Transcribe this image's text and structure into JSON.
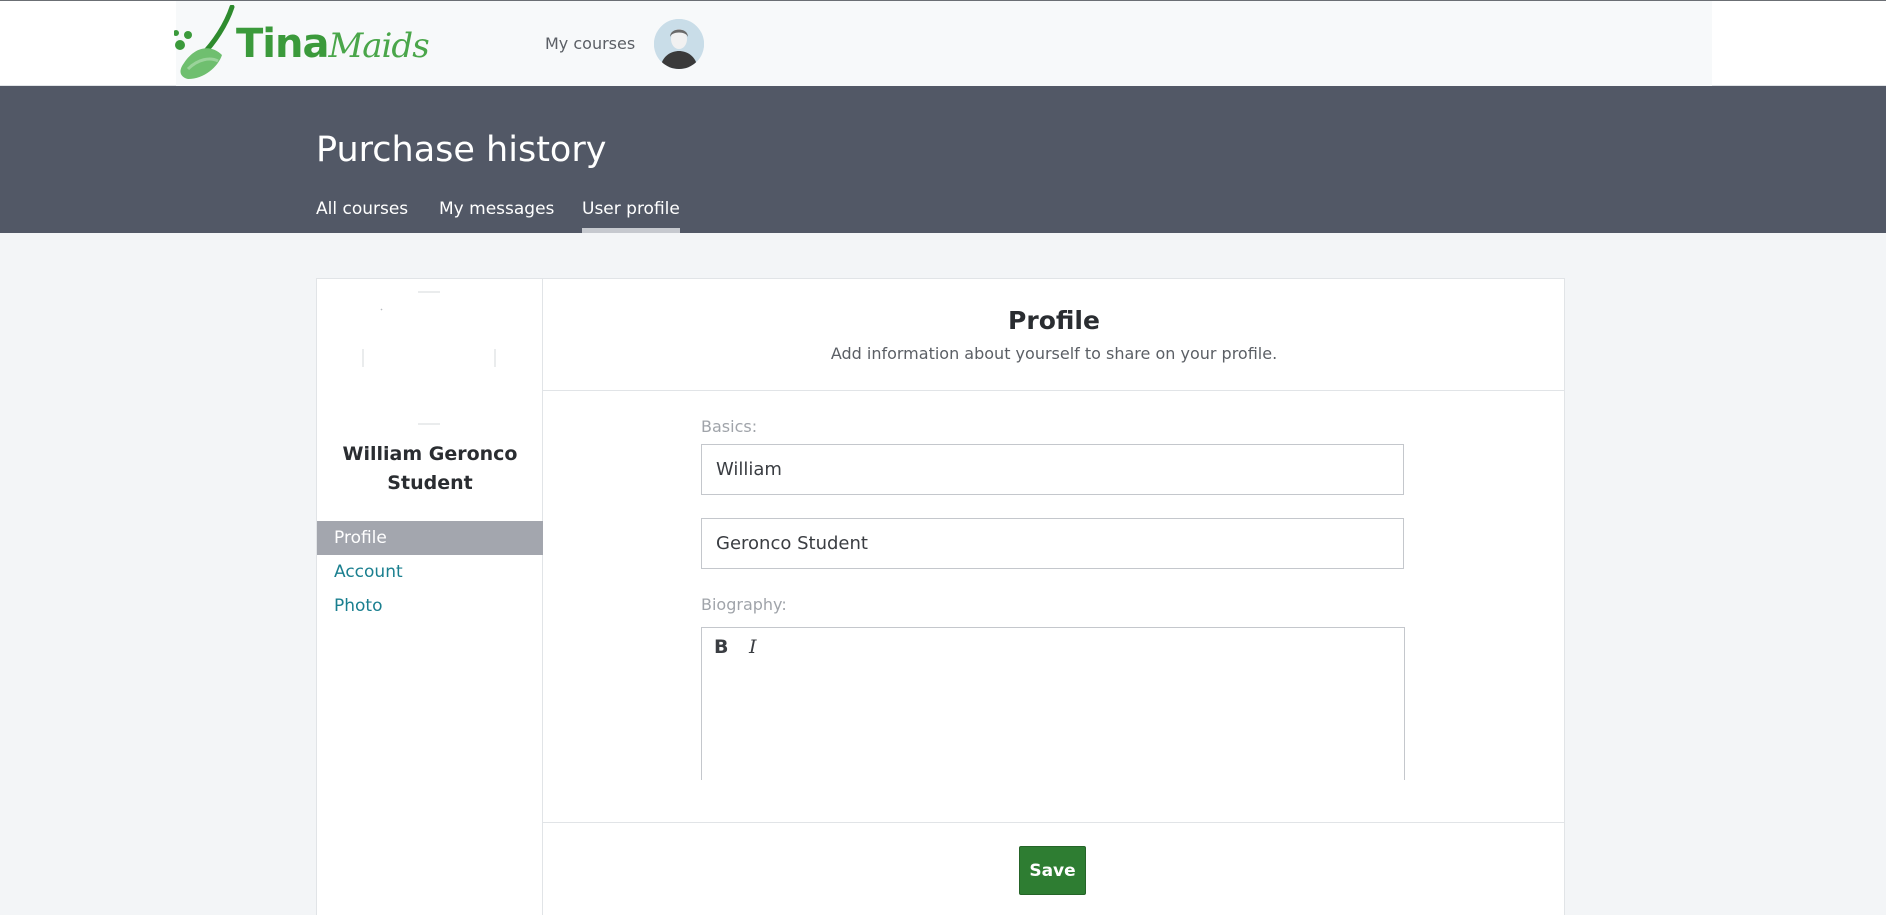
{
  "brand": {
    "name_part1": "Tina",
    "name_part2": "Maids",
    "primary_color": "#3b9a3b"
  },
  "topnav": {
    "my_courses_label": "My courses"
  },
  "header": {
    "title": "Purchase history",
    "tabs": [
      {
        "label": "All courses",
        "active": false
      },
      {
        "label": "My messages",
        "active": false
      },
      {
        "label": "User profile",
        "active": true
      }
    ]
  },
  "sidebar": {
    "user_name": "William Geronco Student",
    "menu": [
      {
        "label": "Profile",
        "active": true
      },
      {
        "label": "Account",
        "active": false
      },
      {
        "label": "Photo",
        "active": false
      }
    ]
  },
  "profile": {
    "title": "Profile",
    "subtitle": "Add information about yourself to share on your profile.",
    "basics_label": "Basics:",
    "first_name_value": "William",
    "last_name_value": "Geronco Student",
    "biography_label": "Biography:",
    "toolbar": {
      "bold_label": "B",
      "italic_label": "I"
    },
    "save_label": "Save"
  },
  "colors": {
    "header_band": "#525866",
    "save_button": "#2e7d32",
    "link": "#1a7f8f",
    "sidebar_active": "#a3a6ae"
  }
}
